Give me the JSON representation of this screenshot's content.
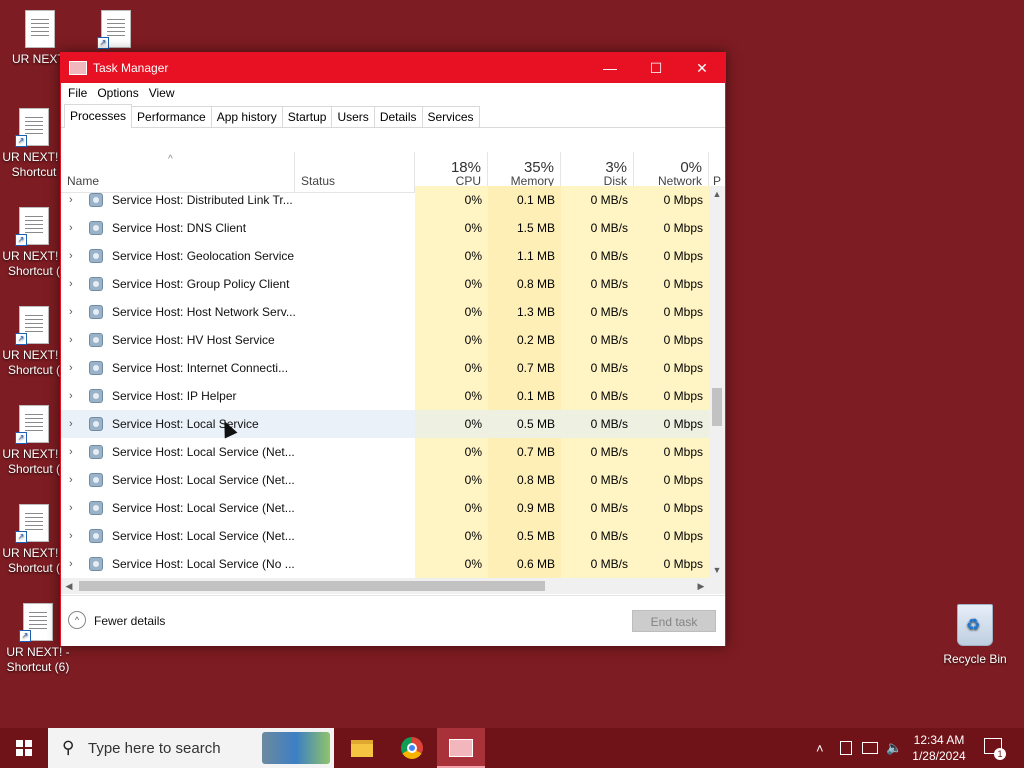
{
  "desktop": {
    "icons": [
      {
        "label": "UR NEXT!"
      },
      {
        "label": ""
      },
      {
        "label": "UR NEXT! - Shortcut"
      },
      {
        "label": "UR NEXT! - Shortcut ("
      },
      {
        "label": "UR NEXT! - Shortcut ("
      },
      {
        "label": "UR NEXT! - Shortcut ("
      },
      {
        "label": "UR NEXT! - Shortcut ("
      },
      {
        "label": "UR NEXT! - Shortcut (6)"
      }
    ],
    "recycle_bin": "Recycle Bin"
  },
  "window": {
    "title": "Task Manager",
    "minimize": "—",
    "maximize": "☐",
    "close": "✕"
  },
  "menu": [
    "File",
    "Options",
    "View"
  ],
  "tabs": [
    "Processes",
    "Performance",
    "App history",
    "Startup",
    "Users",
    "Details",
    "Services"
  ],
  "columns": {
    "name": "Name",
    "status": "Status",
    "cpu": {
      "pct": "18%",
      "label": "CPU"
    },
    "memory": {
      "pct": "35%",
      "label": "Memory"
    },
    "disk": {
      "pct": "3%",
      "label": "Disk"
    },
    "network": {
      "pct": "0%",
      "label": "Network"
    },
    "more": "P"
  },
  "processes": [
    {
      "name": "Service Host: Distributed Link Tr...",
      "cpu": "0%",
      "mem": "0.1 MB",
      "disk": "0 MB/s",
      "net": "0 Mbps"
    },
    {
      "name": "Service Host: DNS Client",
      "cpu": "0%",
      "mem": "1.5 MB",
      "disk": "0 MB/s",
      "net": "0 Mbps"
    },
    {
      "name": "Service Host: Geolocation Service",
      "cpu": "0%",
      "mem": "1.1 MB",
      "disk": "0 MB/s",
      "net": "0 Mbps"
    },
    {
      "name": "Service Host: Group Policy Client",
      "cpu": "0%",
      "mem": "0.8 MB",
      "disk": "0 MB/s",
      "net": "0 Mbps"
    },
    {
      "name": "Service Host: Host Network Serv...",
      "cpu": "0%",
      "mem": "1.3 MB",
      "disk": "0 MB/s",
      "net": "0 Mbps"
    },
    {
      "name": "Service Host: HV Host Service",
      "cpu": "0%",
      "mem": "0.2 MB",
      "disk": "0 MB/s",
      "net": "0 Mbps"
    },
    {
      "name": "Service Host: Internet Connecti...",
      "cpu": "0%",
      "mem": "0.7 MB",
      "disk": "0 MB/s",
      "net": "0 Mbps"
    },
    {
      "name": "Service Host: IP Helper",
      "cpu": "0%",
      "mem": "0.1 MB",
      "disk": "0 MB/s",
      "net": "0 Mbps"
    },
    {
      "name": "Service Host: Local Service",
      "cpu": "0%",
      "mem": "0.5 MB",
      "disk": "0 MB/s",
      "net": "0 Mbps"
    },
    {
      "name": "Service Host: Local Service (Net...",
      "cpu": "0%",
      "mem": "0.7 MB",
      "disk": "0 MB/s",
      "net": "0 Mbps"
    },
    {
      "name": "Service Host: Local Service (Net...",
      "cpu": "0%",
      "mem": "0.8 MB",
      "disk": "0 MB/s",
      "net": "0 Mbps"
    },
    {
      "name": "Service Host: Local Service (Net...",
      "cpu": "0%",
      "mem": "0.9 MB",
      "disk": "0 MB/s",
      "net": "0 Mbps"
    },
    {
      "name": "Service Host: Local Service (Net...",
      "cpu": "0%",
      "mem": "0.5 MB",
      "disk": "0 MB/s",
      "net": "0 Mbps"
    },
    {
      "name": "Service Host: Local Service (No ...",
      "cpu": "0%",
      "mem": "0.6 MB",
      "disk": "0 MB/s",
      "net": "0 Mbps"
    }
  ],
  "selected_row": 8,
  "footer": {
    "fewer_details": "Fewer details",
    "end_task": "End task"
  },
  "taskbar": {
    "search_placeholder": "Type here to search",
    "time": "12:34 AM",
    "date": "1/28/2024",
    "notification_count": "1"
  },
  "colors": {
    "accent": "#e81123",
    "desktop": "#7d1c22",
    "cpu_heat": "#fff4c4"
  }
}
